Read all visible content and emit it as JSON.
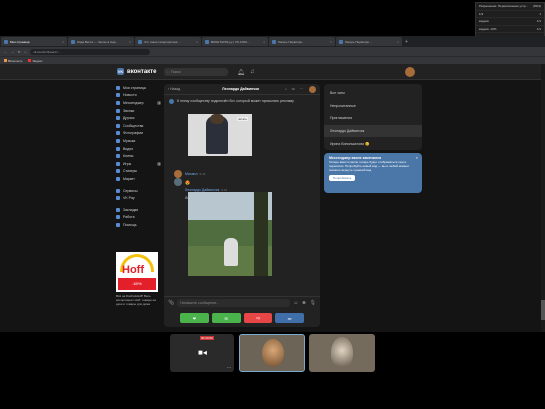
{
  "browser": {
    "tabs": [
      {
        "label": "Моя страница"
      },
      {
        "label": "Лада Веста — Чехлы в Анд..."
      },
      {
        "label": "Что такое гиперпортная ..."
      },
      {
        "label": "ВКОНТАКТЕ.ру | VK.COM..."
      },
      {
        "label": "Лагерь Первопро..."
      },
      {
        "label": "Лагерь Первопро..."
      }
    ],
    "url": "vk.com/im?peers=...",
    "bookmarks": [
      "ВКонтакте",
      "Яндекс"
    ]
  },
  "header": {
    "logo": "вконтакте",
    "search_placeholder": "Поиск"
  },
  "sidebar": {
    "items": [
      {
        "label": "Моя страница"
      },
      {
        "label": "Новости"
      },
      {
        "label": "Мессенджер",
        "count": "1"
      },
      {
        "label": "Звонки"
      },
      {
        "label": "Друзья"
      },
      {
        "label": "Сообщества"
      },
      {
        "label": "Фотографии"
      },
      {
        "label": "Музыка"
      },
      {
        "label": "Видео"
      },
      {
        "label": "Клипы"
      },
      {
        "label": "Игры",
        "count": "3"
      },
      {
        "label": "Стикеры"
      },
      {
        "label": "Маркет"
      },
      {
        "label": "Сервисы"
      },
      {
        "label": "VK Pay"
      },
      {
        "label": "Закладки"
      },
      {
        "label": "Работа"
      },
      {
        "label": "Помощь"
      }
    ],
    "ad": {
      "brand": "Hoff",
      "badge": "-60%",
      "text": "Всё на Dacha&Hoff! Весь ассортимент Hoff: товары на дачи и товары для дома"
    }
  },
  "chat": {
    "back": "Назад",
    "title": "Леонардо Дайвинчик",
    "notice": "К этому сообществу подключён бот, который может присылать рекламу",
    "photo_label": "читать",
    "msg1": {
      "name": "Михаил",
      "time": "9:43",
      "emoji": "😍"
    },
    "msg2": {
      "name": "Леонардо Дайвинчик",
      "time": "9:43",
      "text": "Лиана, 19, 🌷 Уса"
    },
    "compose_placeholder": "Напишите сообщение..."
  },
  "chat_list": {
    "items": [
      "Все чаты",
      "Непрочитанные",
      "Приглашения",
      "Леонардо Дайвинчик",
      "Ирина Вопилшилова 😊"
    ],
    "selected_index": 3
  },
  "tip": {
    "title": "Мессенджер вкопе заменился",
    "text": "Теперь вместо вкопе теперь будет отображаться ленте переписок. Попробуйте новый вид — вы в любой момент сможете вернуть прежний вид",
    "button": "Попробовать"
  },
  "dropdown": {
    "rows": [
      {
        "label": "Разрешение: Переключение устр...",
        "value": "(89,9)"
      },
      {
        "label": "1/3",
        "value": "1"
      },
      {
        "label": "кадров",
        "value": "1/1"
      },
      {
        "label": "кадров, 10%",
        "value": "1/1"
      },
      {
        "label": "",
        "value": "1/1"
      },
      {
        "label": "",
        "value": "1/2"
      },
      {
        "label": "",
        "value": "1/2"
      },
      {
        "label": "",
        "value": "1/1"
      }
    ]
  },
  "video": {
    "rec_label": "00:33:09",
    "tiles": 3
  },
  "colors": {
    "accent": "#4a76a8",
    "green": "#4bb34b",
    "red": "#e64646",
    "blue": "#3f6ea8"
  }
}
